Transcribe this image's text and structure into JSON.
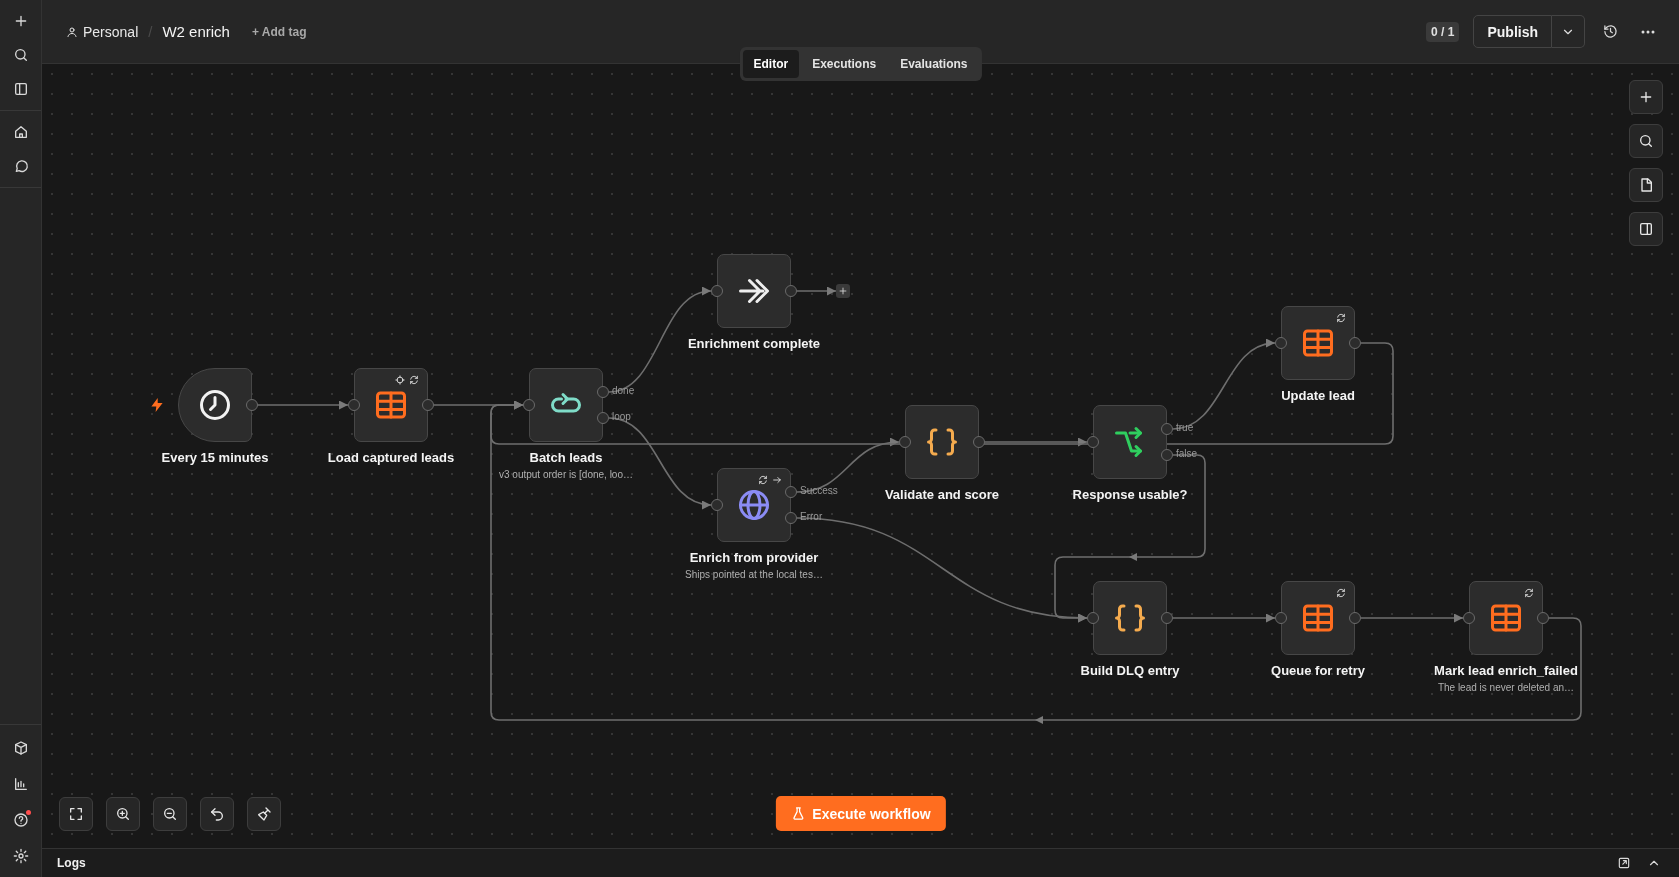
{
  "sidebar": {
    "help_notice": true
  },
  "header": {
    "project": "Personal",
    "separator": "/",
    "workflow_name": "W2 enrich",
    "add_tag": "+ Add tag",
    "counter": "0 / 1",
    "publish": "Publish"
  },
  "tabs": [
    {
      "label": "Editor",
      "selected": true
    },
    {
      "label": "Executions",
      "selected": false
    },
    {
      "label": "Evaluations",
      "selected": false
    }
  ],
  "nodes": [
    {
      "name": "Every 15 minutes",
      "kind": "schedule",
      "retry": false,
      "execute_once": false,
      "continue_on_error": false
    },
    {
      "name": "Load captured leads",
      "kind": "sheet",
      "retry": true,
      "execute_once": true,
      "continue_on_error": false
    },
    {
      "name": "Batch leads",
      "kind": "loop",
      "note": "v3 output order is [done, loo…",
      "outputs": [
        "done",
        "loop"
      ],
      "retry": false,
      "execute_once": false,
      "continue_on_error": false
    },
    {
      "name": "Enrichment complete",
      "kind": "noop",
      "retry": false,
      "execute_once": false,
      "continue_on_error": false
    },
    {
      "name": "Enrich from provider",
      "kind": "http",
      "note": "Ships pointed at the local tes…",
      "outputs": [
        "Success",
        "Error"
      ],
      "retry": true,
      "execute_once": false,
      "continue_on_error": true
    },
    {
      "name": "Validate and score",
      "kind": "code",
      "retry": false,
      "execute_once": false,
      "continue_on_error": false
    },
    {
      "name": "Response usable?",
      "kind": "if",
      "outputs": [
        "true",
        "false"
      ],
      "retry": false,
      "execute_once": false,
      "continue_on_error": false
    },
    {
      "name": "Update lead",
      "kind": "sheet",
      "retry": true,
      "execute_once": false,
      "continue_on_error": false
    },
    {
      "name": "Build DLQ entry",
      "kind": "code",
      "retry": false,
      "execute_once": false,
      "continue_on_error": false
    },
    {
      "name": "Queue for retry",
      "kind": "sheet",
      "retry": true,
      "execute_once": false,
      "continue_on_error": false
    },
    {
      "name": "Mark lead enrich_failed",
      "kind": "sheet",
      "note": "The lead is never deleted an…",
      "retry": true,
      "execute_once": false,
      "continue_on_error": false
    }
  ],
  "execute_button": "Execute workflow",
  "logs": {
    "title": "Logs"
  }
}
